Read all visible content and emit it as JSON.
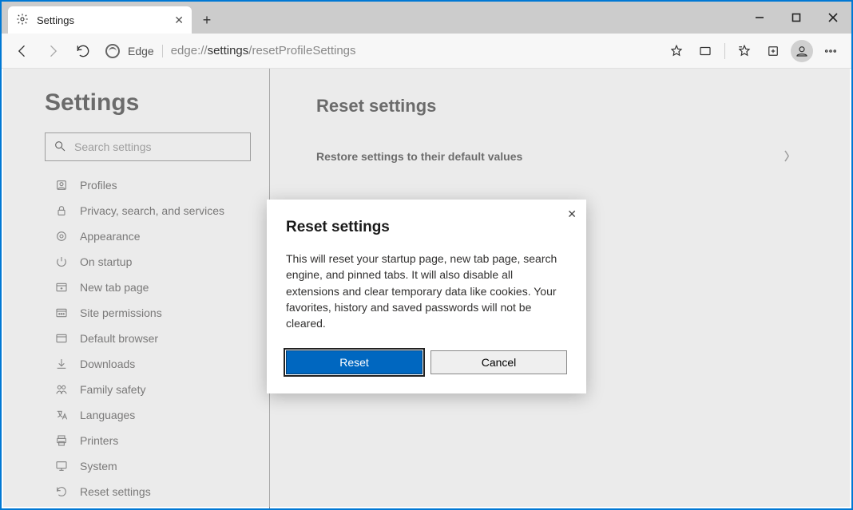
{
  "window": {
    "tab_title": "Settings",
    "new_tab_tooltip": "+"
  },
  "toolbar": {
    "edge_label": "Edge",
    "url_prefix": "edge://",
    "url_mid": "settings",
    "url_suffix": "/resetProfileSettings"
  },
  "sidebar": {
    "title": "Settings",
    "search_placeholder": "Search settings",
    "items": [
      {
        "icon": "profile-icon",
        "label": "Profiles"
      },
      {
        "icon": "lock-icon",
        "label": "Privacy, search, and services"
      },
      {
        "icon": "appearance-icon",
        "label": "Appearance"
      },
      {
        "icon": "power-icon",
        "label": "On startup"
      },
      {
        "icon": "newtab-icon",
        "label": "New tab page"
      },
      {
        "icon": "permissions-icon",
        "label": "Site permissions"
      },
      {
        "icon": "default-browser-icon",
        "label": "Default browser"
      },
      {
        "icon": "download-icon",
        "label": "Downloads"
      },
      {
        "icon": "family-icon",
        "label": "Family safety"
      },
      {
        "icon": "language-icon",
        "label": "Languages"
      },
      {
        "icon": "printer-icon",
        "label": "Printers"
      },
      {
        "icon": "system-icon",
        "label": "System"
      },
      {
        "icon": "reset-icon",
        "label": "Reset settings"
      }
    ]
  },
  "main": {
    "heading": "Reset settings",
    "row_label": "Restore settings to their default values"
  },
  "modal": {
    "title": "Reset settings",
    "body": "This will reset your startup page, new tab page, search engine, and pinned tabs. It will also disable all extensions and clear temporary data like cookies. Your favorites, history and saved passwords will not be cleared.",
    "primary": "Reset",
    "secondary": "Cancel"
  }
}
